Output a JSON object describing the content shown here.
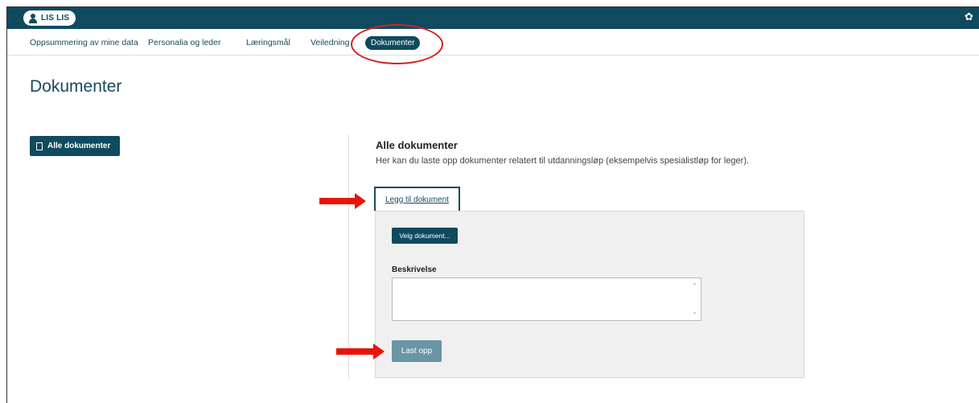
{
  "header": {
    "user_name": "LIS LIS",
    "settings_icon": "gear-icon",
    "user_icon": "user-icon",
    "bar_color": "#0f4a5f"
  },
  "tabs": [
    {
      "label": "Oppsummering av mine data"
    },
    {
      "label": "Personalia og leder"
    },
    {
      "label": "Læringsmål"
    },
    {
      "label": "Veiledning"
    },
    {
      "label": "Dokumenter",
      "active": true
    }
  ],
  "page": {
    "title": "Dokumenter"
  },
  "sidebar": {
    "all_documents_label": "Alle dokumenter",
    "icon": "document-icon"
  },
  "main": {
    "section_title": "Alle dokumenter",
    "description": "Her kan du laste opp dokumenter relatert til utdanningsløp (eksempelvis spesialistløp for leger).",
    "add_document_label": "Legg til dokument",
    "choose_document_label": "Velg dokument...",
    "description_label": "Beskrivelse",
    "description_value": "",
    "upload_label": "Last opp"
  },
  "annotations": {
    "highlight_color": "#d62020",
    "arrow_color": "#e8140c"
  }
}
